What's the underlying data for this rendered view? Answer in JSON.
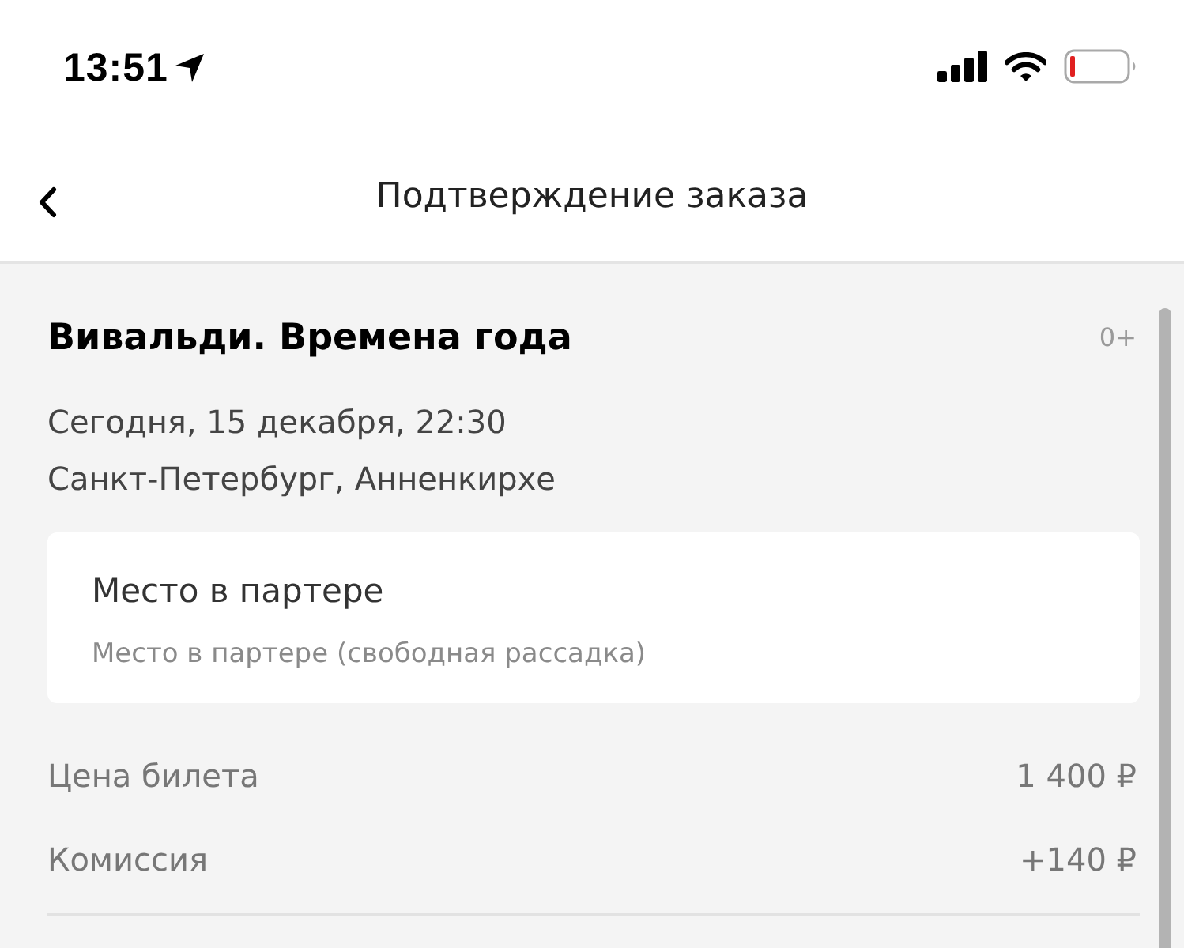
{
  "status_bar": {
    "time": "13:51"
  },
  "nav_bar": {
    "title": "Подтверждение заказа"
  },
  "event": {
    "title": "Вивальди. Времена года",
    "age_rating": "0+",
    "date": "Сегодня, 15 декабря, 22:30",
    "venue": "Санкт-Петербург, Анненкирхе"
  },
  "ticket": {
    "title": "Место в партере",
    "description": "Место в партере (свободная рассадка)"
  },
  "price_rows": [
    {
      "label": "Цена билета",
      "value": "1 400 ₽"
    },
    {
      "label": "Комиссия",
      "value": "+140 ₽"
    }
  ]
}
